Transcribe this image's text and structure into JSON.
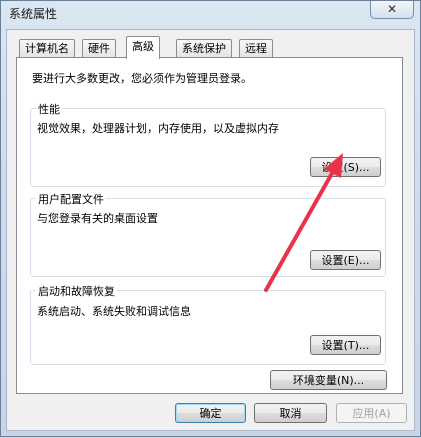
{
  "window": {
    "title": "系统属性",
    "close_label": "✕"
  },
  "tabs": [
    {
      "label": "计算机名"
    },
    {
      "label": "硬件"
    },
    {
      "label": "高级"
    },
    {
      "label": "系统保护"
    },
    {
      "label": "远程"
    }
  ],
  "notice": "要进行大多数更改，您必须作为管理员登录。",
  "performance": {
    "title": "性能",
    "desc": "视觉效果，处理器计划，内存使用，以及虚拟内存",
    "button": "设置(S)..."
  },
  "profiles": {
    "title": "用户配置文件",
    "desc": "与您登录有关的桌面设置",
    "button": "设置(E)..."
  },
  "startup": {
    "title": "启动和故障恢复",
    "desc": "系统启动、系统失败和调试信息",
    "button": "设置(T)..."
  },
  "env_button": "环境变量(N)...",
  "footer": {
    "ok": "确定",
    "cancel": "取消",
    "apply": "应用(A)"
  },
  "annotation_color": "#e8334a"
}
